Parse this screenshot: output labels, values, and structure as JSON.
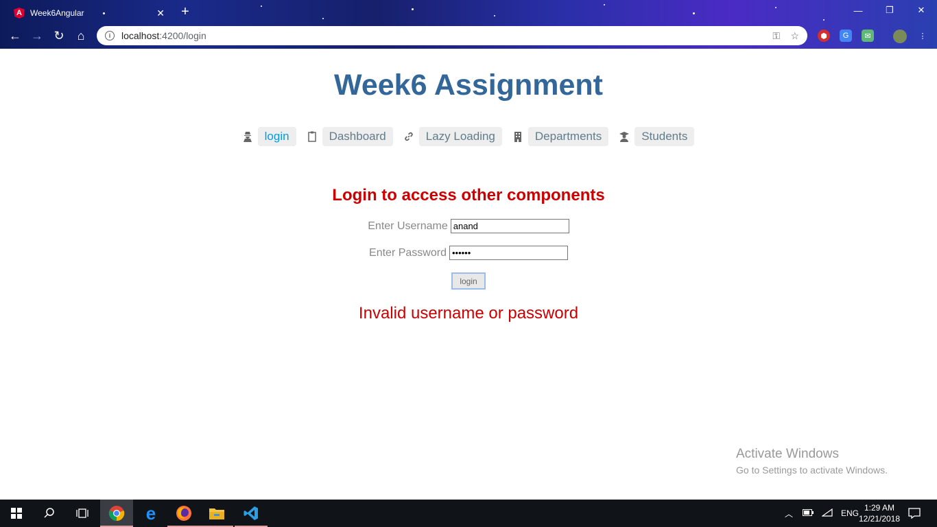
{
  "browser": {
    "tab_title": "Week6Angular",
    "tab_logo": "A",
    "url_host": "localhost",
    "url_path": ":4200/login",
    "icons": {
      "back": "arrow-left-icon",
      "forward": "arrow-right-icon",
      "reload": "reload-icon",
      "home": "home-icon",
      "info": "info-icon",
      "key": "key-icon",
      "star": "star-icon",
      "menu": "kebab-menu-icon"
    }
  },
  "page": {
    "title": "Week6 Assignment",
    "nav": [
      {
        "label": "login",
        "icon": "user-secret-icon",
        "active": true
      },
      {
        "label": "Dashboard",
        "icon": "clipboard-icon",
        "active": false
      },
      {
        "label": "Lazy Loading",
        "icon": "link-icon",
        "active": false
      },
      {
        "label": "Departments",
        "icon": "building-icon",
        "active": false
      },
      {
        "label": "Students",
        "icon": "graduate-icon",
        "active": false
      }
    ],
    "login_heading": "Login to access other components",
    "username_label": "Enter Username",
    "username_value": "anand",
    "password_label": "Enter Password",
    "password_value": "••••••",
    "login_button": "login",
    "error_message": "Invalid username or password"
  },
  "watermark": {
    "title": "Activate Windows",
    "subtitle": "Go to Settings to activate Windows."
  },
  "taskbar": {
    "language": "ENG",
    "time": "1:29 AM",
    "date": "12/21/2018"
  },
  "colors": {
    "title": "#336699",
    "error": "#cc0000",
    "nav_active": "#039be5",
    "nav_inactive": "#607d8b"
  }
}
